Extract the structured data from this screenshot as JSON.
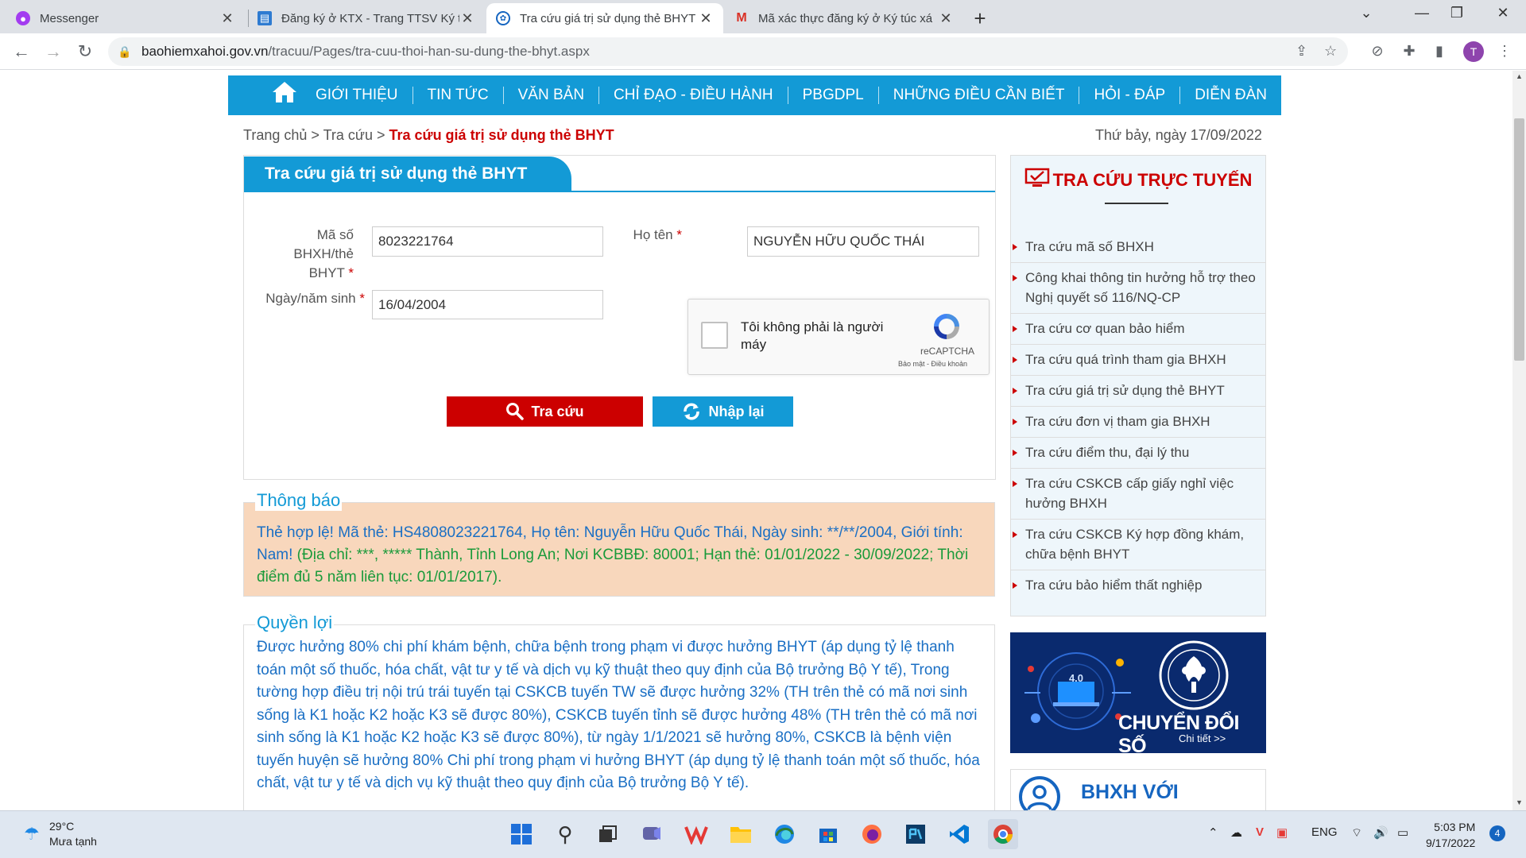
{
  "browser": {
    "tabs": [
      {
        "title": "Messenger",
        "active": false
      },
      {
        "title": "Đăng ký ở KTX - Trang TTSV Ký túc",
        "active": false
      },
      {
        "title": "Tra cứu giá trị sử dụng thẻ BHYT",
        "active": true
      },
      {
        "title": "Mã xác thực đăng ký ở Ký túc xá",
        "active": false
      }
    ],
    "url_host": "baohiemxahoi.gov.vn",
    "url_path": "/tracuu/Pages/tra-cuu-thoi-han-su-dung-the-bhyt.aspx",
    "profile_initial": "T"
  },
  "nav": {
    "items": [
      "GIỚI THIỆU",
      "TIN TỨC",
      "VĂN BẢN",
      "CHỈ ĐẠO - ĐIỀU HÀNH",
      "PBGDPL",
      "NHỮNG ĐIỀU CẦN BIẾT",
      "HỎI - ĐÁP",
      "DIỄN ĐÀN"
    ]
  },
  "breadcrumb": {
    "home": "Trang chủ >",
    "lookup": "Tra cứu >",
    "current": "Tra cứu giá trị sử dụng thẻ BHYT"
  },
  "date_text": "Thứ bảy, ngày 17/09/2022",
  "form": {
    "title": "Tra cứu giá trị sử dụng thẻ BHYT",
    "id_label_1": "Mã số BHXH/thẻ",
    "id_label_2": "BHYT",
    "id_value": "8023221764",
    "name_label": "Họ tên",
    "name_value": "NGUYỄN HỮU QUỐC THÁI",
    "dob_label": "Ngày/năm sinh",
    "dob_value": "16/04/2004",
    "required_mark": "*",
    "captcha_text": "Tôi không phải là người máy",
    "captcha_brand": "reCAPTCHA",
    "captcha_terms": "Bảo mật - Điều khoản",
    "search_button": "Tra cứu",
    "reset_button": "Nhập lại"
  },
  "notice": {
    "title": "Thông báo",
    "lead": "Thẻ hợp lệ! Mã thẻ: HS4808023221764, Họ tên: Nguyễn Hữu Quốc Thái, Ngày sinh: **/**/2004, Giới tính: Nam!",
    "detail": " (Địa chỉ: ***, ***** Thành, Tỉnh Long An; Nơi KCBBĐ: 80001; Hạn thẻ: 01/01/2022 - 30/09/2022; Thời điểm đủ 5 năm liên tục: 01/01/2017)."
  },
  "rights": {
    "title": "Quyền lợi",
    "text": "Được hưởng 80% chi phí khám bệnh, chữa bệnh trong phạm vi được hưởng BHYT (áp dụng tỷ lệ thanh toán một số thuốc, hóa chất, vật tư y tế và dịch vụ kỹ thuật theo quy định của Bộ trưởng Bộ Y tế), Trong tường hợp điều trị nội trú trái tuyến tại CSKCB tuyến TW sẽ được hưởng 32% (TH trên thẻ có mã nơi sinh sống là K1 hoặc K2 hoặc K3 sẽ được 80%), CSKCB tuyến tỉnh sẽ được hưởng 48% (TH trên thẻ có mã nơi sinh sống là K1 hoặc K2 hoặc K3 sẽ được 80%), từ ngày 1/1/2021 sẽ hưởng 80%, CSKCB là bệnh viện tuyến huyện sẽ hưởng 80% Chi phí trong phạm vi hưởng BHYT (áp dụng tỷ lệ thanh toán một số thuốc, hóa chất, vật tư y tế và dịch vụ kỹ thuật theo quy định của Bộ trưởng Bộ Y tế)."
  },
  "sidebar": {
    "title": "TRA CỨU TRỰC TUYẾN",
    "items": [
      "Tra cứu mã số BHXH",
      "Công khai thông tin hưởng hỗ trợ theo Nghị quyết số 116/NQ-CP",
      "Tra cứu cơ quan bảo hiểm",
      "Tra cứu quá trình tham gia BHXH",
      "Tra cứu giá trị sử dụng thẻ BHYT",
      "Tra cứu đơn vị tham gia BHXH",
      "Tra cứu điểm thu, đại lý thu",
      "Tra cứu CSKCB cấp giấy nghỉ việc hưởng BHXH",
      "Tra cứu CSKCB Ký hợp đồng khám, chữa bệnh BHYT",
      "Tra cứu bảo hiểm thất nghiệp"
    ],
    "banner_title": "CHUYỂN ĐỔI SỐ",
    "banner_link": "Chi tiết >>",
    "banner_badge": "4.0",
    "bhxh_box_title": "BHXH VỚI"
  },
  "taskbar": {
    "temp": "29°C",
    "weather": "Mưa tạnh",
    "lang": "ENG",
    "time": "5:03 PM",
    "date": "9/17/2022",
    "notifications": "4"
  },
  "colors": {
    "brand_blue": "#139ad6",
    "brand_red": "#cc0000",
    "notice_bg": "#f8d7bc",
    "notice_green": "#1a9a3a",
    "text_blue": "#1a6fc4"
  }
}
